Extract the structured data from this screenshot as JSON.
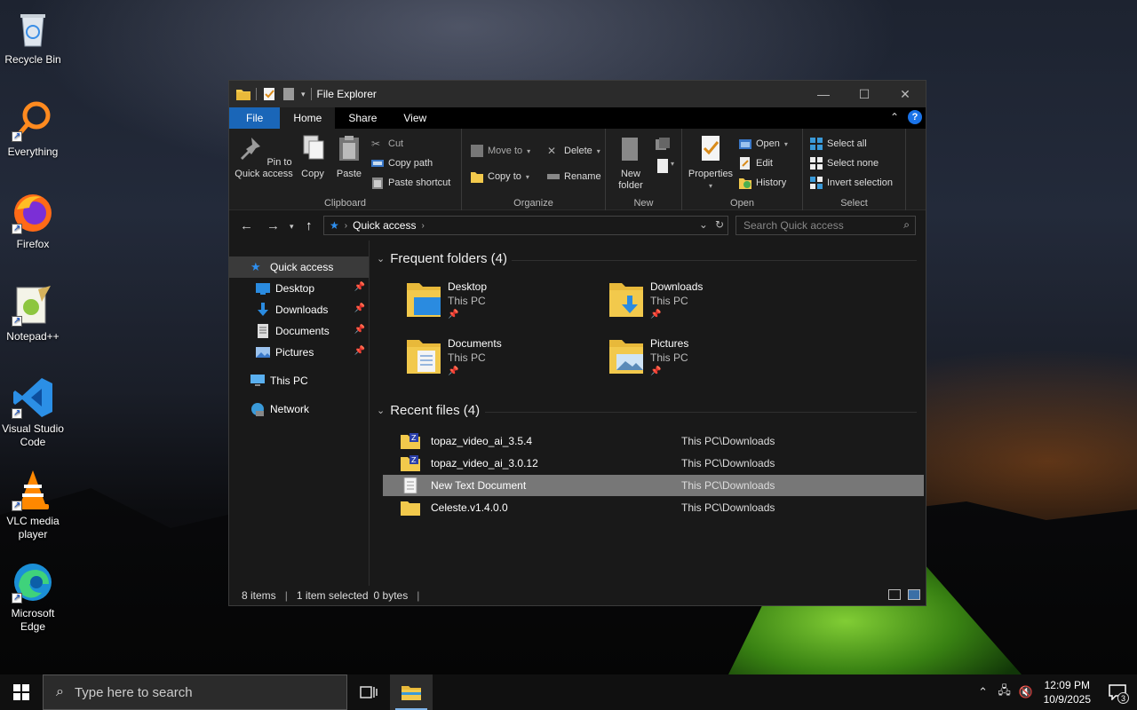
{
  "desktop": {
    "icons": [
      {
        "label": "Recycle Bin",
        "icon": "recycle-bin-icon"
      },
      {
        "label": "Everything",
        "icon": "everything-search-icon"
      },
      {
        "label": "Firefox",
        "icon": "firefox-icon"
      },
      {
        "label": "Notepad++",
        "icon": "notepad-plus-plus-icon"
      },
      {
        "label": "Visual Studio Code",
        "icon": "vscode-icon"
      },
      {
        "label": "VLC media player",
        "icon": "vlc-icon"
      },
      {
        "label": "Microsoft Edge",
        "icon": "edge-icon"
      }
    ]
  },
  "window": {
    "title": "File Explorer",
    "tabs": [
      "File",
      "Home",
      "Share",
      "View"
    ],
    "active_tab": "Home"
  },
  "ribbon": {
    "clipboard": {
      "label": "Clipboard",
      "pin": "Pin to Quick access",
      "copy": "Copy",
      "paste": "Paste",
      "cut": "Cut",
      "copy_path": "Copy path",
      "paste_shortcut": "Paste shortcut"
    },
    "organize": {
      "label": "Organize",
      "move_to": "Move to",
      "copy_to": "Copy to",
      "delete": "Delete",
      "rename": "Rename"
    },
    "new": {
      "label": "New",
      "new_folder": "New folder"
    },
    "open": {
      "label": "Open",
      "properties": "Properties",
      "open": "Open",
      "edit": "Edit",
      "history": "History"
    },
    "select": {
      "label": "Select",
      "select_all": "Select all",
      "select_none": "Select none",
      "invert": "Invert selection"
    }
  },
  "address": {
    "location": "Quick access",
    "search_placeholder": "Search Quick access"
  },
  "nav_pane": {
    "items": [
      {
        "label": "Quick access",
        "icon": "star-icon"
      },
      {
        "label": "Desktop",
        "icon": "desktop-folder-icon"
      },
      {
        "label": "Downloads",
        "icon": "downloads-icon"
      },
      {
        "label": "Documents",
        "icon": "documents-icon"
      },
      {
        "label": "Pictures",
        "icon": "pictures-icon"
      },
      {
        "label": "This PC",
        "icon": "computer-icon"
      },
      {
        "label": "Network",
        "icon": "network-icon"
      }
    ]
  },
  "frequent": {
    "title": "Frequent folders (4)",
    "folders": [
      {
        "name": "Desktop",
        "location": "This PC"
      },
      {
        "name": "Downloads",
        "location": "This PC"
      },
      {
        "name": "Documents",
        "location": "This PC"
      },
      {
        "name": "Pictures",
        "location": "This PC"
      }
    ]
  },
  "recent": {
    "title": "Recent files (4)",
    "files": [
      {
        "name": "topaz_video_ai_3.5.4",
        "path": "This PC\\Downloads"
      },
      {
        "name": "topaz_video_ai_3.0.12",
        "path": "This PC\\Downloads"
      },
      {
        "name": "New Text Document",
        "path": "This PC\\Downloads"
      },
      {
        "name": "Celeste.v1.4.0.0",
        "path": "This PC\\Downloads"
      }
    ]
  },
  "status": {
    "items": "8 items",
    "selected": "1 item selected",
    "size": "0 bytes"
  },
  "taskbar": {
    "search_placeholder": "Type here to search",
    "time": "12:09 PM",
    "date": "10/9/2025",
    "notification_count": "3"
  },
  "colors": {
    "accent": "#1a66b8",
    "folder": "#f2c94c",
    "selection": "#777777"
  }
}
